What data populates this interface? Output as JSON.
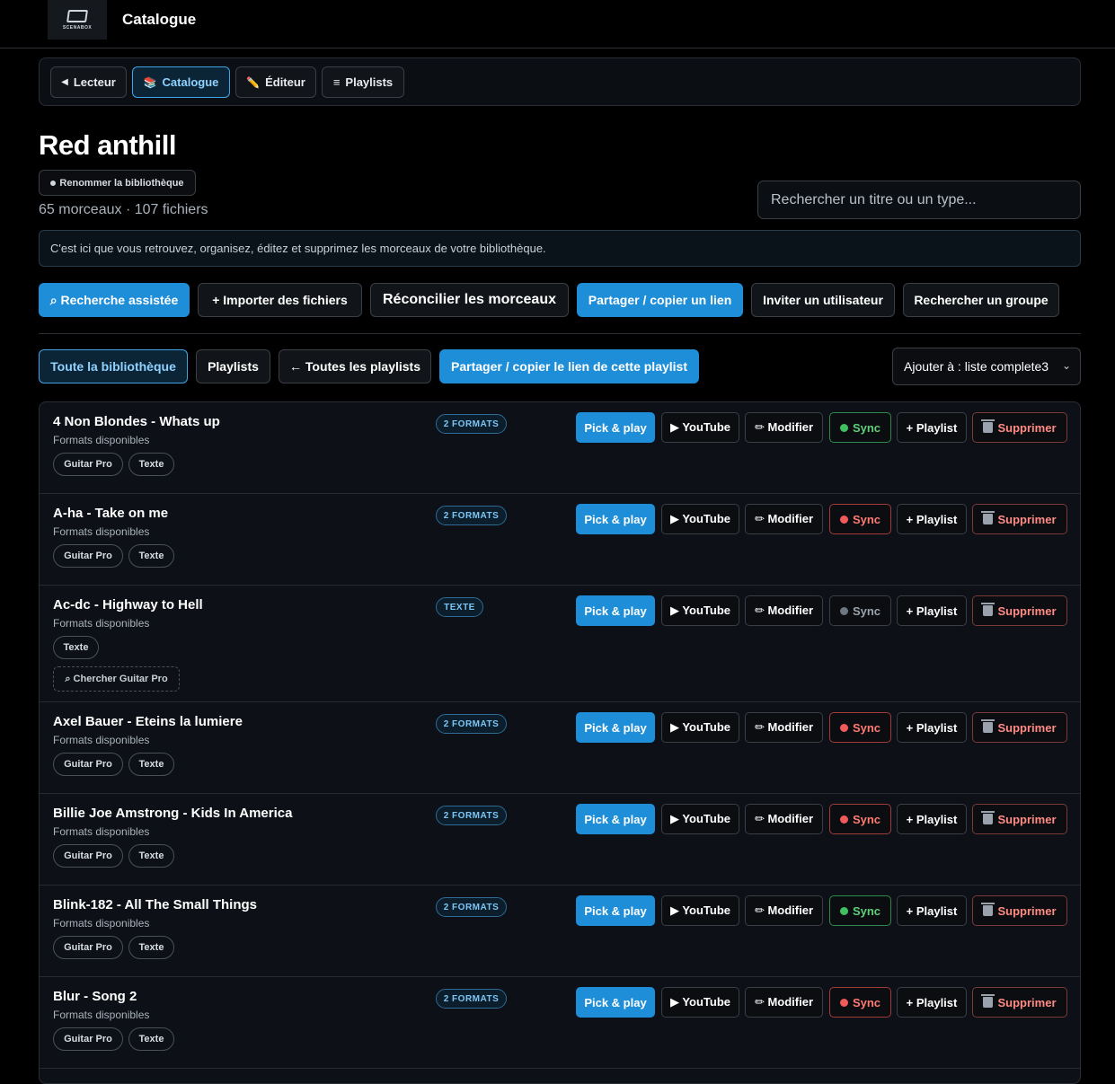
{
  "app": {
    "title": "Catalogue",
    "logo_text": "SCENABOX"
  },
  "nav": [
    {
      "icon": "◀",
      "label": "Lecteur"
    },
    {
      "icon": "📚",
      "label": "Catalogue"
    },
    {
      "icon": "✏️",
      "label": "Éditeur"
    },
    {
      "icon": "≡",
      "label": "Playlists"
    }
  ],
  "library": {
    "name": "Red anthill",
    "rename_label": "Renommer la bibliothèque",
    "counts": "65 morceaux · 107 fichiers",
    "search_placeholder": "Rechercher un titre ou un type...",
    "info": "C'est ici que vous retrouvez, organisez, éditez et supprimez les morceaux de votre bibliothèque."
  },
  "actions": {
    "assisted": "⌕ Recherche assistée",
    "import": "+ Importer des fichiers",
    "reconcile": "Réconcilier les morceaux",
    "share": "Partager / copier un lien",
    "invite": "Inviter un utilisateur",
    "group": "Rechercher un groupe"
  },
  "filters": {
    "all": "Toute la bibliothèque",
    "playlists": "Playlists",
    "all_playlists": "← Toutes les playlists",
    "share_playlist": "Partager / copier le lien de cette playlist",
    "add_to": "Ajouter à : liste complete3"
  },
  "row_buttons": {
    "pick": "Pick & play",
    "youtube": "▶ YouTube",
    "modify": "✏ Modifier",
    "sync": "Sync",
    "playlist": "+ Playlist",
    "delete": "Supprimer"
  },
  "formats_label": "Formats disponibles",
  "search_gp_label": "⌕ Chercher Guitar Pro",
  "colors": {
    "accent": "#1f8ed8",
    "sync_green": "#3fbf5f",
    "sync_red": "#f05a5a",
    "sync_gray": "#6e7681"
  },
  "songs": [
    {
      "title": "4 Non Blondes - Whats up",
      "badge": "2 FORMATS",
      "tags": [
        "Guitar Pro",
        "Texte"
      ],
      "sync": "green"
    },
    {
      "title": "A-ha - Take on me",
      "badge": "2 FORMATS",
      "tags": [
        "Guitar Pro",
        "Texte"
      ],
      "sync": "red"
    },
    {
      "title": "Ac-dc - Highway to Hell",
      "badge": "TEXTE",
      "tags": [
        "Texte"
      ],
      "sync": "gray"
    },
    {
      "title": "Axel Bauer - Eteins la lumiere",
      "badge": "2 FORMATS",
      "tags": [
        "Guitar Pro",
        "Texte"
      ],
      "sync": "red"
    },
    {
      "title": "Billie Joe Amstrong - Kids In America",
      "badge": "2 FORMATS",
      "tags": [
        "Guitar Pro",
        "Texte"
      ],
      "sync": "red"
    },
    {
      "title": "Blink-182 - All The Small Things",
      "badge": "2 FORMATS",
      "tags": [
        "Guitar Pro",
        "Texte"
      ],
      "sync": "green"
    },
    {
      "title": "Blur - Song 2",
      "badge": "2 FORMATS",
      "tags": [
        "Guitar Pro",
        "Texte"
      ],
      "sync": "red"
    }
  ]
}
